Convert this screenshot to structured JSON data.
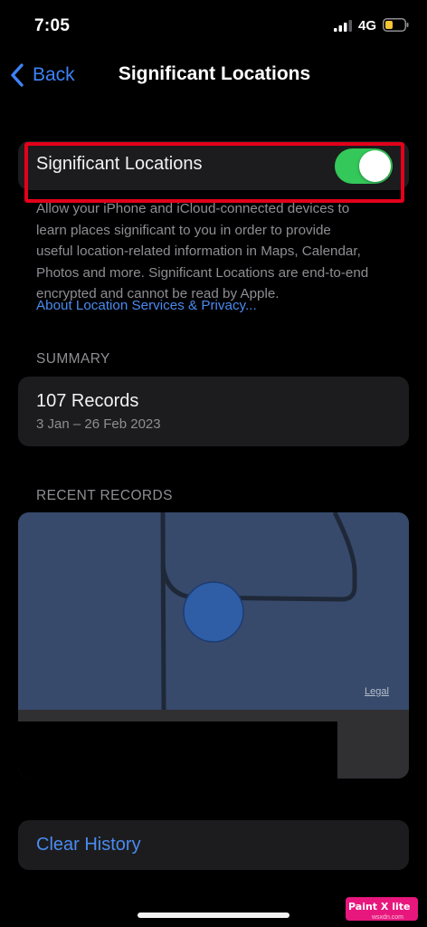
{
  "status_bar": {
    "time": "7:05",
    "network": "4G",
    "icons": [
      "signal-bars-icon",
      "battery-low-icon"
    ],
    "battery_color": "#f4c534"
  },
  "nav": {
    "back_label": "Back",
    "title": "Significant Locations",
    "back_icon": "chevron-left-icon"
  },
  "toggle": {
    "label": "Significant Locations",
    "state": "on",
    "on_color": "#34c759"
  },
  "footer": {
    "lines": [
      "Allow your iPhone and iCloud-connected devices to",
      "learn places significant to you in order to provide",
      "useful location-related information in Maps, Calendar,",
      "Photos and more. Significant Locations are end-to-end",
      "encrypted and cannot be read by Apple."
    ],
    "link": "About Location Services & Privacy..."
  },
  "summary": {
    "header": "SUMMARY",
    "title": "107 Records",
    "range": "3 Jan – 26 Feb 2023"
  },
  "recent": {
    "header": "RECENT RECORDS",
    "legal": "Legal"
  },
  "actions": {
    "clear_history": "Clear History"
  },
  "watermark": {
    "brand": "Paint X lite",
    "site": "wsxdn.com"
  },
  "colors": {
    "accent": "#4a8bf0",
    "highlight": "#e3001b",
    "map_bg": "#374a6b"
  }
}
